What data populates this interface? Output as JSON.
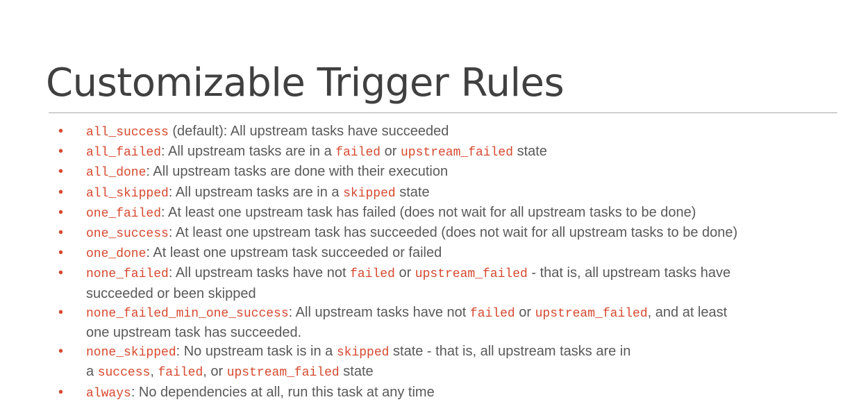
{
  "slide": {
    "title": "Customizable Trigger Rules",
    "bullet_marker": "•",
    "bullets": [
      {
        "parts": [
          {
            "code": "all_success"
          },
          {
            "text": " (default): All upstream tasks have succeeded"
          }
        ]
      },
      {
        "parts": [
          {
            "code": "all_failed"
          },
          {
            "text": ": All upstream tasks are in a "
          },
          {
            "code": "failed"
          },
          {
            "text": " or "
          },
          {
            "code": "upstream_failed"
          },
          {
            "text": " state"
          }
        ]
      },
      {
        "parts": [
          {
            "code": "all_done"
          },
          {
            "text": ": All upstream tasks are done with their execution"
          }
        ]
      },
      {
        "parts": [
          {
            "code": "all_skipped"
          },
          {
            "text": ": All upstream tasks are in a "
          },
          {
            "code": "skipped"
          },
          {
            "text": " state"
          }
        ]
      },
      {
        "parts": [
          {
            "code": "one_failed"
          },
          {
            "text": ": At least one upstream task has failed (does not wait for all upstream tasks to be done)"
          }
        ]
      },
      {
        "parts": [
          {
            "code": "one_success"
          },
          {
            "text": ": At least one upstream task has succeeded (does not wait for all upstream tasks to be done)"
          }
        ]
      },
      {
        "parts": [
          {
            "code": "one_done"
          },
          {
            "text": ": At least one upstream task succeeded or failed"
          }
        ]
      },
      {
        "parts": [
          {
            "code": "none_failed"
          },
          {
            "text": ": All upstream tasks have not "
          },
          {
            "code": "failed"
          },
          {
            "text": " or "
          },
          {
            "code": "upstream_failed"
          },
          {
            "text": " - that is, all upstream tasks have"
          },
          {
            "br": true
          },
          {
            "text": "succeeded or been skipped"
          }
        ]
      },
      {
        "parts": [
          {
            "code": "none_failed_min_one_success"
          },
          {
            "text": ": All upstream tasks have not "
          },
          {
            "code": "failed"
          },
          {
            "text": " or "
          },
          {
            "code": "upstream_failed"
          },
          {
            "text": ", and at least"
          },
          {
            "br": true
          },
          {
            "text": "one upstream task has succeeded."
          }
        ]
      },
      {
        "parts": [
          {
            "code": "none_skipped"
          },
          {
            "text": ": No upstream task is in a "
          },
          {
            "code": "skipped"
          },
          {
            "text": " state - that is, all upstream tasks are in"
          },
          {
            "br": true
          },
          {
            "text": "a "
          },
          {
            "code": "success"
          },
          {
            "text": ", "
          },
          {
            "code": "failed"
          },
          {
            "text": ", or "
          },
          {
            "code": "upstream_failed"
          },
          {
            "text": " state"
          }
        ]
      },
      {
        "parts": [
          {
            "code": "always"
          },
          {
            "text": ": No dependencies at all, run this task at any time"
          }
        ]
      }
    ]
  },
  "colors": {
    "title": "#404040",
    "body_text": "#595959",
    "code_accent": "#d6492f",
    "divider": "#a6a6a6"
  }
}
